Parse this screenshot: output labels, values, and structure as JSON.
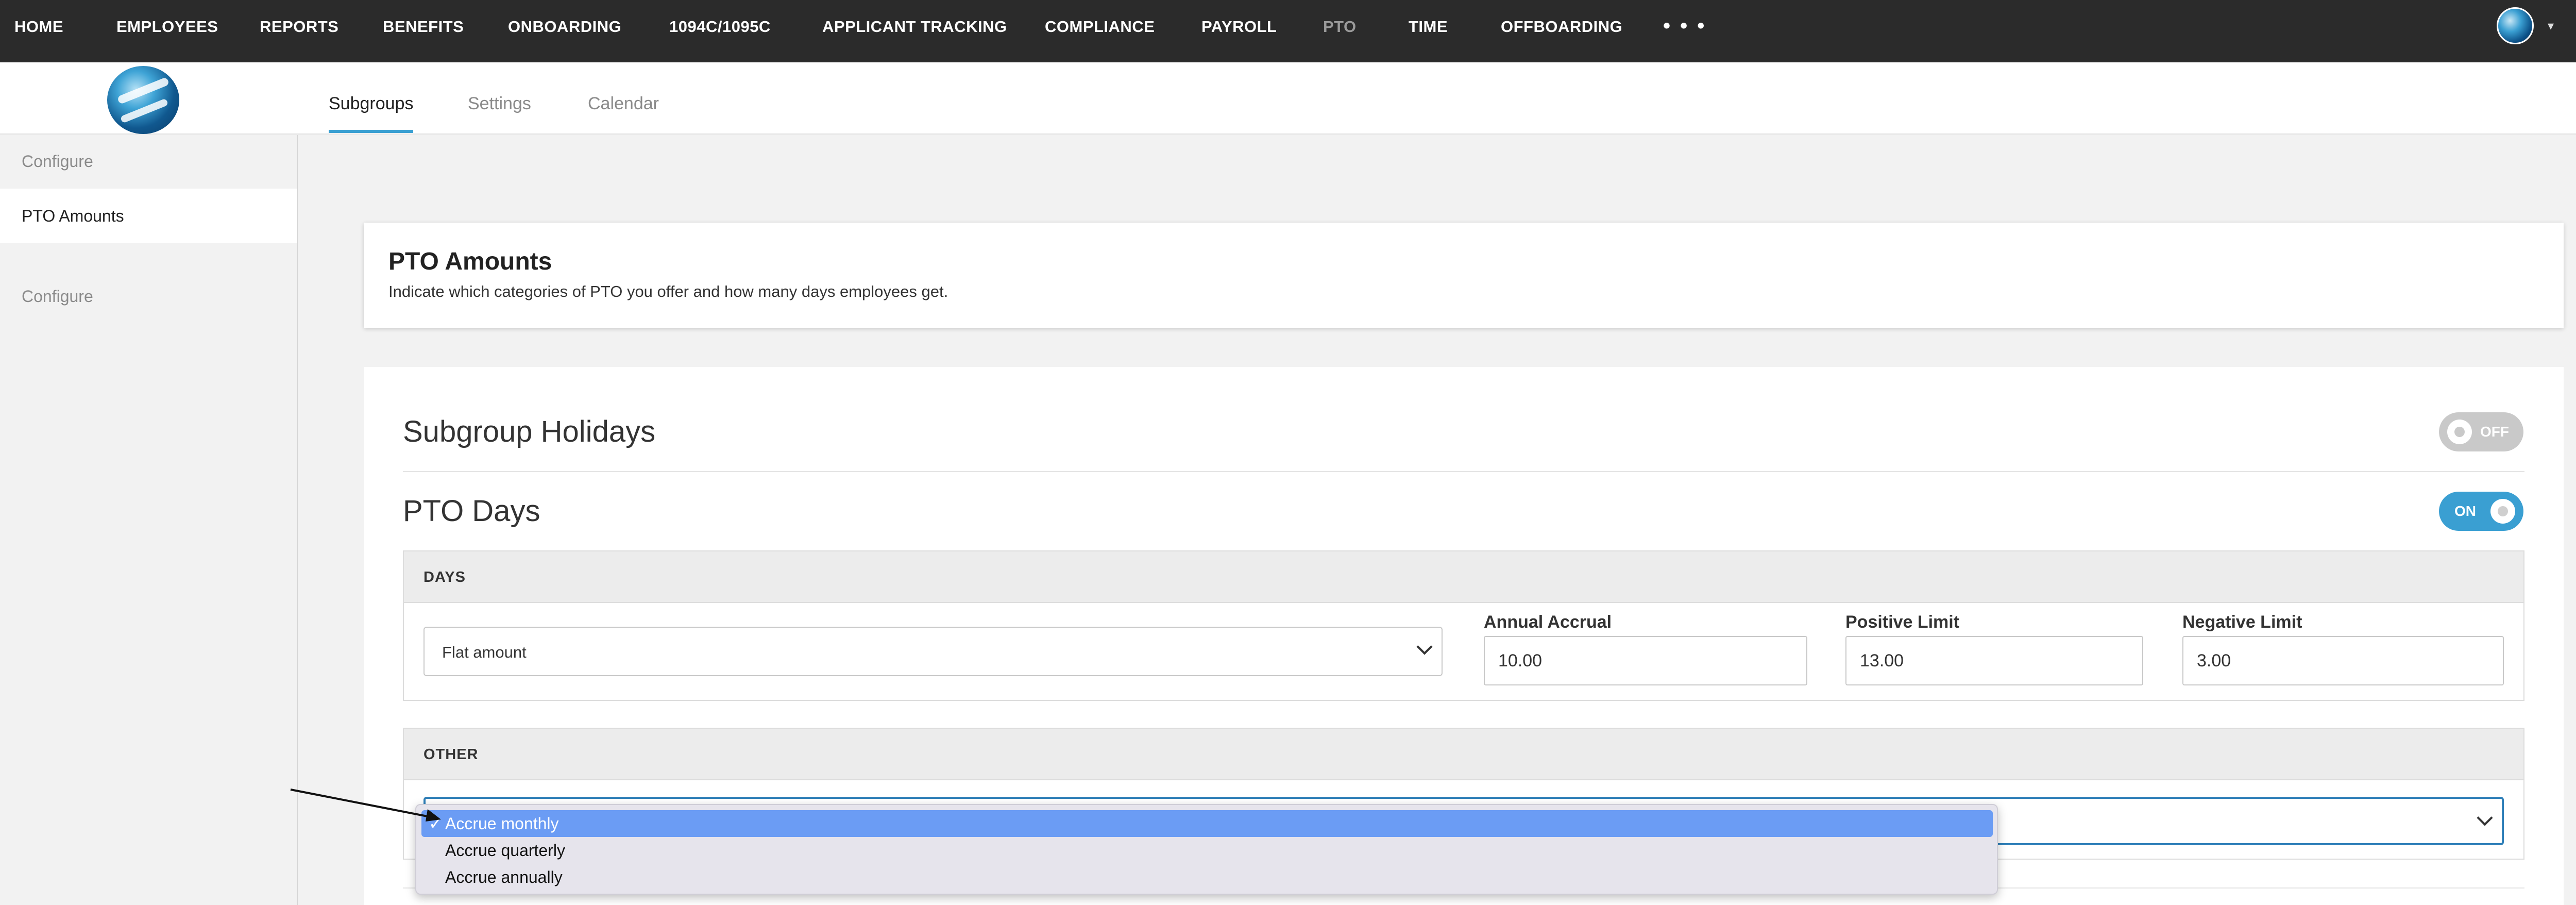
{
  "topnav": {
    "items": [
      {
        "label": "HOME"
      },
      {
        "label": "EMPLOYEES"
      },
      {
        "label": "REPORTS"
      },
      {
        "label": "BENEFITS"
      },
      {
        "label": "ONBOARDING"
      },
      {
        "label": "1094C/1095C"
      },
      {
        "label": "APPLICANT TRACKING"
      },
      {
        "label": "COMPLIANCE"
      },
      {
        "label": "PAYROLL"
      },
      {
        "label": "PTO"
      },
      {
        "label": "TIME"
      },
      {
        "label": "OFFBOARDING"
      }
    ],
    "more": "• • •",
    "caret": "▾"
  },
  "header": {
    "tabs": [
      {
        "label": "Subgroups"
      },
      {
        "label": "Settings"
      },
      {
        "label": "Calendar"
      }
    ]
  },
  "sidebar": {
    "items": [
      {
        "label": "Configure"
      },
      {
        "label": "PTO Amounts"
      }
    ]
  },
  "intro": {
    "title": "PTO Amounts",
    "subtitle": "Indicate which categories of PTO you offer and how many days employees get."
  },
  "sections": {
    "holidays": {
      "title": "Subgroup Holidays",
      "toggle": "OFF"
    },
    "pto_days": {
      "title": "PTO Days",
      "toggle": "ON"
    }
  },
  "days_panel": {
    "heading": "DAYS",
    "method": "Flat amount",
    "annual_accrual": {
      "label": "Annual Accrual",
      "value": "10.00"
    },
    "positive_limit": {
      "label": "Positive Limit",
      "value": "13.00"
    },
    "negative_limit": {
      "label": "Negative Limit",
      "value": "3.00"
    }
  },
  "other_panel": {
    "heading": "OTHER"
  },
  "dropdown": {
    "check": "✓",
    "options": [
      {
        "label": "Accrue monthly"
      },
      {
        "label": "Accrue quarterly"
      },
      {
        "label": "Accrue annually"
      }
    ]
  }
}
